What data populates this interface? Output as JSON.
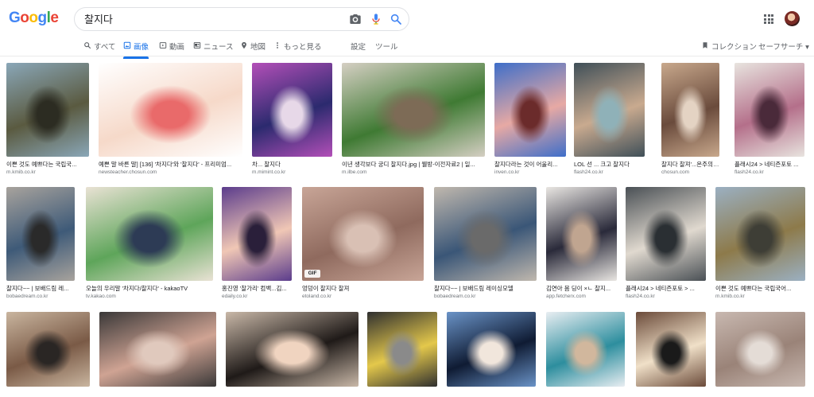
{
  "logo": {
    "letters": [
      "G",
      "o",
      "o",
      "g",
      "l",
      "e"
    ],
    "colors": [
      "#4285f4",
      "#ea4335",
      "#fbbc05",
      "#4285f4",
      "#34a853",
      "#ea4335"
    ]
  },
  "search": {
    "query": "찰지다",
    "icons": [
      "camera-icon",
      "microphone-icon",
      "search-icon"
    ]
  },
  "tabs": [
    {
      "label": "すべて",
      "icon": "search-icon",
      "active": false
    },
    {
      "label": "画像",
      "icon": "image-icon",
      "active": true
    },
    {
      "label": "動画",
      "icon": "video-icon",
      "active": false
    },
    {
      "label": "ニュース",
      "icon": "news-icon",
      "active": false
    },
    {
      "label": "地図",
      "icon": "map-pin-icon",
      "active": false
    },
    {
      "label": "もっと見る",
      "icon": "more-vertical-icon",
      "active": false
    },
    {
      "label": "設定",
      "icon": "",
      "active": false
    },
    {
      "label": "ツール",
      "icon": "",
      "active": false
    }
  ],
  "right_tools": {
    "collections": "コレクション",
    "safesearch": "セーフサーチ ▾"
  },
  "colors": {
    "accent": "#1a73e8",
    "text_secondary": "#70757a"
  },
  "rows": [
    [
      {
        "title": "이쁜 것도 예쁘다는 국립국...",
        "source": "m.kmib.co.kr",
        "colors": [
          "#8aa7b8",
          "#5a5a40",
          "#2c2c22"
        ],
        "gif": false
      },
      {
        "title": "예쁜 말 바른 말] [136] '차지다'와 '찰지다' - 프리미엄...",
        "source": "newsteacher.chosun.com",
        "colors": [
          "#ffffff",
          "#f6d9c9",
          "#e96a6a"
        ],
        "gif": false
      },
      {
        "title": "차... 찰지다",
        "source": "m.mimint.co.kr",
        "colors": [
          "#b34fb8",
          "#2b2a6e",
          "#e7d8e8"
        ],
        "gif": false
      },
      {
        "title": "이년 생각보다 궁디 찰지다.jpg | 웰방-이전자료2 | 일...",
        "source": "m.ilbe.com",
        "colors": [
          "#d5cfc3",
          "#3f7a33",
          "#7d6b56"
        ],
        "gif": false
      },
      {
        "title": "찰지다라는 것이 어울리...",
        "source": "inven.co.kr",
        "colors": [
          "#3e6ec9",
          "#e7a9a4",
          "#6b2b2b"
        ],
        "gif": false
      },
      {
        "title": "LOL 선 ... 크고 찰지다",
        "source": "flash24.co.kr",
        "colors": [
          "#3f4f58",
          "#c9aa8f",
          "#8fb1b8"
        ],
        "gif": false
      },
      {
        "title": "찰지다 찰져'...온주의 ...",
        "source": "chosun.com",
        "colors": [
          "#c8a88c",
          "#6a4b3c",
          "#e4d3c3"
        ],
        "gif": false
      },
      {
        "title": "플래시24 > 네티즌포토 ...",
        "source": "flash24.co.kr",
        "colors": [
          "#e8e4df",
          "#b46f8a",
          "#4a2a3a"
        ],
        "gif": false
      }
    ],
    [
      {
        "title": "찰지다~~ | 보배드림 레...",
        "source": "bobaedream.co.kr",
        "colors": [
          "#a8a39d",
          "#3e5a78",
          "#2a2a2a"
        ],
        "gif": false
      },
      {
        "title": "오늘의 우리말 '차지다/찰지다' - kakaoTV",
        "source": "tv.kakao.com",
        "colors": [
          "#e9e2d4",
          "#5ea55a",
          "#2d3b55"
        ],
        "gif": false
      },
      {
        "title": "홍진영 '찰가리' 컴백...김...",
        "source": "edaily.co.kr",
        "colors": [
          "#5b3c8c",
          "#f0c7b5",
          "#2a1f3a"
        ],
        "gif": false
      },
      {
        "title": "엉덩이 찰지다 찰져",
        "source": "etoland.co.kr",
        "colors": [
          "#c8a597",
          "#8f6a5e",
          "#d9c0b4"
        ],
        "gif": true
      },
      {
        "title": "찰지다~~ | 보배드림 레이싱모델",
        "source": "bobaedream.co.kr",
        "colors": [
          "#c0b8ae",
          "#3a5677",
          "#6a6a6a"
        ],
        "gif": false
      },
      {
        "title": "김연아 몸 딩이 ×ㄴ 찰지...",
        "source": "app.fetcherx.com",
        "colors": [
          "#e9e6e2",
          "#2a2a3a",
          "#c0a590"
        ],
        "gif": false
      },
      {
        "title": "플래시24 > 네티즌포토 > ...",
        "source": "flash24.co.kr",
        "colors": [
          "#4a5055",
          "#e0d9cf",
          "#2a2f33"
        ],
        "gif": false
      },
      {
        "title": "이쁜 것도 예쁘다는 국립국어...",
        "source": "m.kmib.co.kr",
        "colors": [
          "#9bb0c2",
          "#8d7a4a",
          "#3e3e36"
        ],
        "gif": false
      }
    ],
    [
      {
        "title": "",
        "source": "",
        "colors": [
          "#c9b59f",
          "#7a5a46",
          "#2a2624"
        ],
        "gif": false
      },
      {
        "title": "",
        "source": "",
        "colors": [
          "#3a3838",
          "#cfa393",
          "#e0c9bd"
        ],
        "gif": false
      },
      {
        "title": "",
        "source": "",
        "colors": [
          "#c9b8a8",
          "#1f1a18",
          "#f0d4c0"
        ],
        "gif": false
      },
      {
        "title": "",
        "source": "",
        "colors": [
          "#2f2f2f",
          "#e4c84b",
          "#8a8a8a"
        ],
        "gif": false
      },
      {
        "title": "",
        "source": "",
        "colors": [
          "#6a93c7",
          "#0f1b33",
          "#f1e6dc"
        ],
        "gif": false
      },
      {
        "title": "",
        "source": "",
        "colors": [
          "#e9eef2",
          "#2d8e9e",
          "#d1b79d"
        ],
        "gif": false
      },
      {
        "title": "",
        "source": "",
        "colors": [
          "#6b4b3a",
          "#f0e0c8",
          "#1a1a1a"
        ],
        "gif": false
      },
      {
        "title": "",
        "source": "",
        "colors": [
          "#c8b8b0",
          "#9a8378",
          "#e4dcd6"
        ],
        "gif": false
      }
    ]
  ]
}
